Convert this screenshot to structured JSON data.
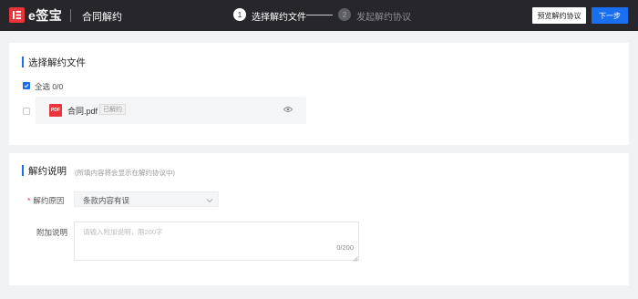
{
  "header": {
    "logo_text": "e签宝",
    "page_title": "合同解约",
    "steps": [
      {
        "number": "1",
        "label": "选择解约文件"
      },
      {
        "number": "2",
        "label": "发起解约协议"
      }
    ],
    "preview_button": "预览解约协议",
    "next_button": "下一步"
  },
  "file_section": {
    "title": "选择解约文件",
    "select_all_label": "全选 0/0",
    "files": [
      {
        "name": "合同.pdf",
        "icon_text": "PDF",
        "tag": "已解约"
      }
    ]
  },
  "reason_section": {
    "title": "解约说明",
    "hint": "(所填内容将会显示在解约协议中)",
    "reason_label": "解约原因",
    "reason_required": "*",
    "reason_value": "条款内容有误",
    "note_label": "附加说明",
    "note_placeholder": "请输入附加说明，限200字",
    "note_count": "0/200"
  },
  "colors": {
    "topbar": "#26262b",
    "accent": "#1a6ff0",
    "brand_red": "#e9343b"
  }
}
